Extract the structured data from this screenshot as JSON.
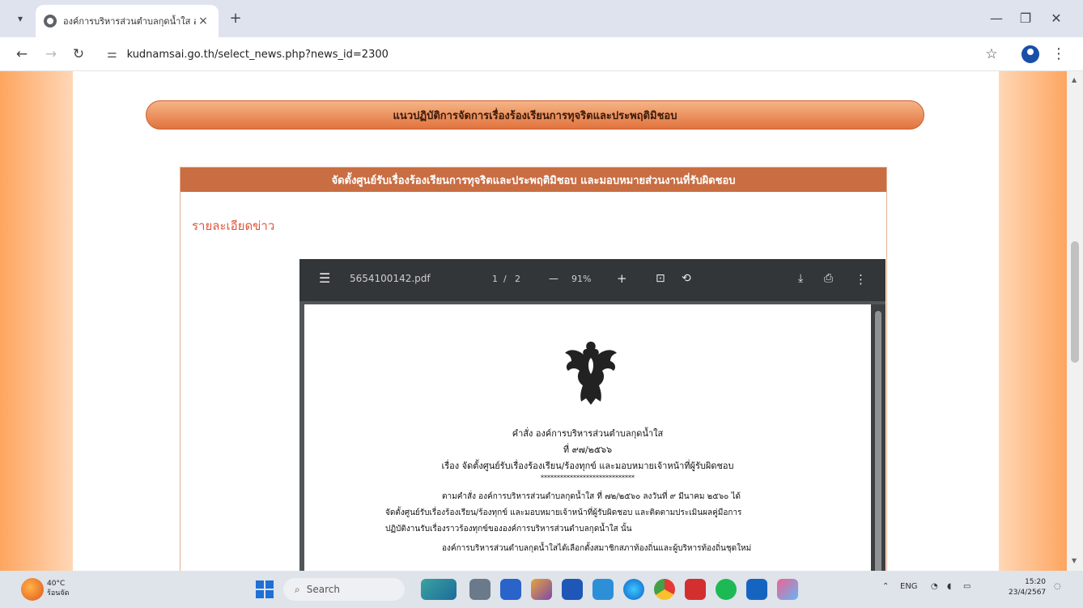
{
  "browser": {
    "tab_title": "องค์การบริหารส่วนตำบลกุดน้ำใส อ",
    "tab_close": "×",
    "new_tab": "+",
    "url": "kudnamsai.go.th/select_news.php?news_id=2300"
  },
  "page": {
    "banner_title": "แนวปฏิบัติการจัดการเรื่องร้องเรียนการทุจริตและประพฤติมิชอบ",
    "news_title": "จัดตั้งศูนย์รับเรื่องร้องเรียนการทุจริตและประพฤติมิชอบ และมอบหมายส่วนงานที่รับผิดชอบ",
    "detail_label": "รายละเอียดข่าว"
  },
  "pdf_viewer": {
    "file_name": "5654100142.pdf",
    "page_current": "1",
    "page_sep": "/",
    "page_total": "2",
    "zoom": "91%",
    "zoom_out": "—",
    "zoom_in": "+"
  },
  "document": {
    "order_line": "คำสั่ง องค์การบริหารส่วนตำบลกุดน้ำใส",
    "number_line": "ที่ ๙๗/๒๕๖๖",
    "subject_line": "เรื่อง จัดตั้งศูนย์รับเรื่องร้องเรียน/ร้องทุกข์ และมอบหมายเจ้าหน้าที่ผู้รับผิดชอบ",
    "separator": "*****************************",
    "para1_line1": "ตามคำสั่ง องค์การบริหารส่วนตำบลกุดน้ำใส ที่ ๗๒/๒๕๖๐ ลงวันที่ ๙ มีนาคม ๒๕๖๐ ได้",
    "para1_line2": "จัดตั้งศูนย์รับเรื่องร้องเรียน/ร้องทุกข์ และมอบหมายเจ้าหน้าที่ผู้รับผิดชอบ และติดตามประเมินผลคู่มือการ",
    "para1_line3": "ปฏิบัติงานรับเรื่องราวร้องทุกข์ขององค์การบริหารส่วนตำบลกุดน้ำใส นั้น",
    "para2_line1": "องค์การบริหารส่วนตำบลกุดน้ำใสได้เลือกตั้งสมาชิกสภาท้องถิ่นและผู้บริหารท้องถิ่นชุดใหม่"
  },
  "taskbar": {
    "weather_temp": "40°C",
    "weather_desc": "ร้อนจัด",
    "search": "Search",
    "lang": "ENG",
    "time": "15:20",
    "date": "23/4/2567"
  },
  "colors": {
    "side_orange": "#fda55f",
    "banner_orange": "#e0733d",
    "news_header": "#c96d42",
    "detail_label": "#e0563b",
    "pdf_toolbar": "#323639"
  }
}
